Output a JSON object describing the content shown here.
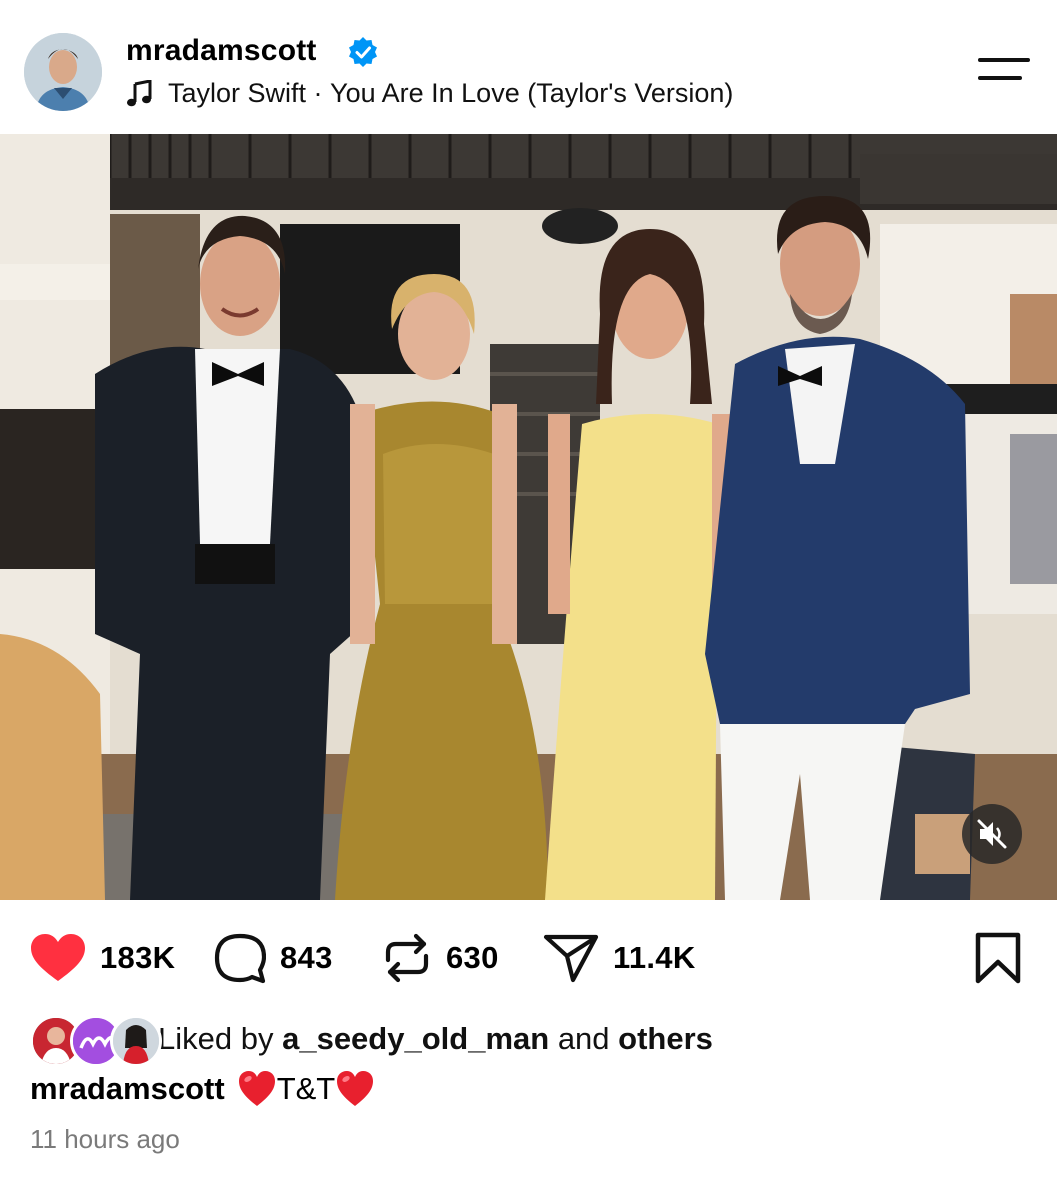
{
  "post": {
    "username": "mradamscott",
    "verified": true,
    "music": {
      "artist": "Taylor Swift",
      "separator": " · ",
      "track": "You Are In Love (Taylor's Version)"
    },
    "media": {
      "type": "photo",
      "mute_icon": "muted-speaker-icon"
    },
    "stats": {
      "likes": "183K",
      "comments": "843",
      "reposts": "630",
      "shares": "11.4K"
    },
    "liked_by": {
      "prefix": "Liked by",
      "user": "a_seedy_old_man",
      "middle": "and",
      "others": "others"
    },
    "caption": {
      "username": "mradamscott",
      "text": "T&T"
    },
    "timestamp": "11 hours ago"
  },
  "icons": {
    "menu": "hamburger-menu-icon",
    "like": "heart-filled-icon",
    "comment": "comment-bubble-icon",
    "repost": "repost-icon",
    "share": "send-icon",
    "bookmark": "bookmark-icon"
  },
  "colors": {
    "like_red": "#ff3040",
    "verified_blue": "#0095f6",
    "timestamp_gray": "#7a7a7a"
  }
}
